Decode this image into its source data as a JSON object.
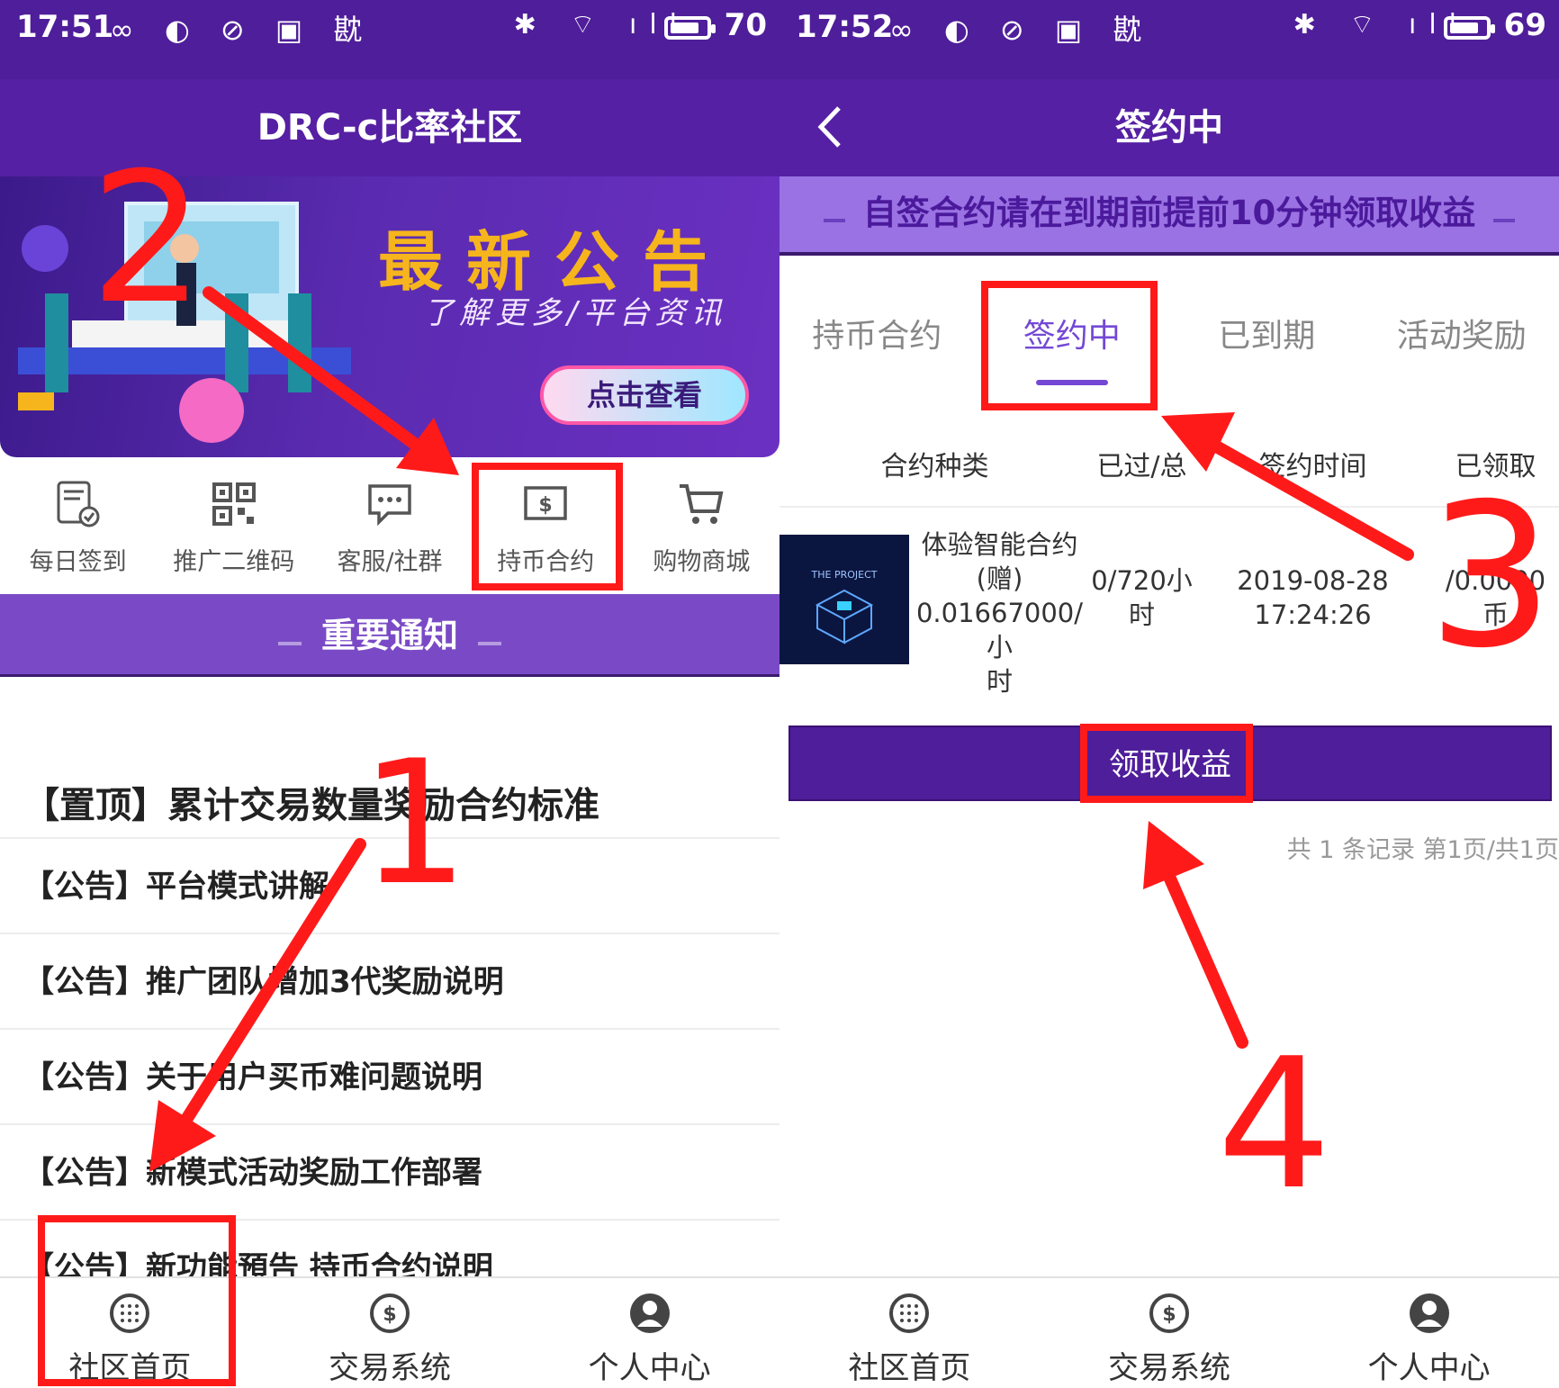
{
  "left": {
    "status": {
      "time": "17:51",
      "battery": "70",
      "icons_left": "∞ ◐ ⊘ ▣ 㽎",
      "icons_right": "✱ ⌔ ıll"
    },
    "title": "DRC-c比率社区",
    "banner": {
      "title": "最新公告",
      "subtitle": "了解更多/平台资讯",
      "button": "点击查看"
    },
    "quick_menu": [
      {
        "label": "每日签到",
        "icon": "checkin-icon"
      },
      {
        "label": "推广二维码",
        "icon": "qr-code-icon"
      },
      {
        "label": "客服/社群",
        "icon": "chat-icon"
      },
      {
        "label": "持币合约",
        "icon": "coin-contract-icon"
      },
      {
        "label": "购物商城",
        "icon": "cart-icon"
      }
    ],
    "notice_title": "重要通知",
    "announcements": [
      "【置顶】累计交易数量奖励合约标准",
      "【公告】平台模式讲解",
      "【公告】推广团队增加3代奖励说明",
      "【公告】关于用户买币难问题说明",
      "【公告】新模式活动奖励工作部署",
      "【公告】新功能預告 持币合约说明"
    ],
    "bottom_nav": [
      {
        "label": "社区首页",
        "icon": "community-icon"
      },
      {
        "label": "交易系统",
        "icon": "trade-icon"
      },
      {
        "label": "个人中心",
        "icon": "user-icon"
      }
    ]
  },
  "right": {
    "status": {
      "time": "17:52",
      "battery": "69",
      "icons_left": "∞ ◐ ⊘ ▣ 㽎",
      "icons_right": "✱ ⌔ ıll"
    },
    "title": "签约中",
    "tip": "自签合约请在到期前提前10分钟领取收益",
    "tabs": [
      {
        "label": "持币合约",
        "active": false
      },
      {
        "label": "签约中",
        "active": true
      },
      {
        "label": "已到期",
        "active": false
      },
      {
        "label": "活动奖励",
        "active": false
      }
    ],
    "table": {
      "headers": [
        "合约种类",
        "已过/总时",
        "签约时间",
        "已领取"
      ],
      "row": {
        "thumb_title": "THE PROJECT",
        "name_lines": [
          "体验智能合约",
          "(赠)",
          "0.01667000/小",
          "时"
        ],
        "elapsed_lines": [
          "0/720小",
          "时"
        ],
        "time_lines": [
          "2019-08-28",
          "17:24:26"
        ],
        "claimed_lines": [
          "/0.0000",
          "币"
        ]
      }
    },
    "claim_button": "领取收益",
    "records": "共 1 条记录 第1页/共1页",
    "bottom_nav": [
      {
        "label": "社区首页",
        "icon": "community-icon"
      },
      {
        "label": "交易系统",
        "icon": "trade-icon"
      },
      {
        "label": "个人中心",
        "icon": "user-icon"
      }
    ]
  },
  "annotations": {
    "step1": "1",
    "step2": "2",
    "step3": "3",
    "step4": "4",
    "color": "#ff1a1a"
  },
  "colors": {
    "primary": "#5520a3",
    "status_bar": "#4f1e9a",
    "accent": "#7448d4",
    "banner_gold": "#f6b51c"
  }
}
